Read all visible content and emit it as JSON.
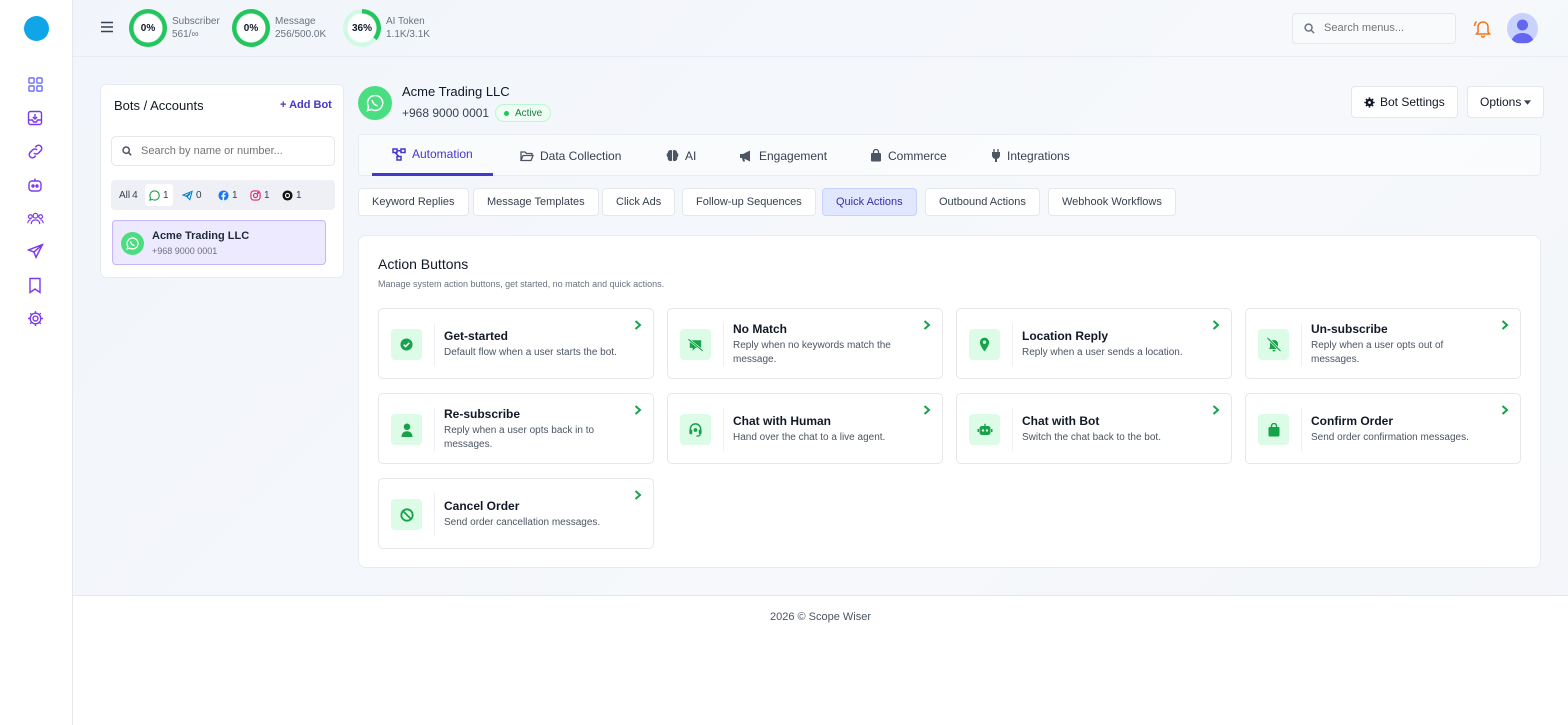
{
  "sidebar": {
    "icons": [
      "grid-icon",
      "inbox-icon",
      "link-icon",
      "robot-icon",
      "users-icon",
      "send-icon",
      "bookmark-icon",
      "gear-icon"
    ]
  },
  "topbar": {
    "stats": [
      {
        "pct": "0%",
        "label": "Subscriber",
        "value": "561/∞",
        "fill": 0
      },
      {
        "pct": "0%",
        "label": "Message",
        "value": "256/500.0K",
        "fill": 0
      },
      {
        "pct": "36%",
        "label": "AI Token",
        "value": "1.1K/3.1K",
        "fill": 36
      }
    ],
    "search_placeholder": "Search menus..."
  },
  "bots_panel": {
    "title": "Bots / Accounts",
    "add_label": "Add Bot",
    "search_placeholder": "Search by name or number...",
    "filters": [
      {
        "label": "All",
        "count": "4"
      },
      {
        "icon": "whatsapp-icon",
        "count": "1"
      },
      {
        "icon": "telegram-icon",
        "count": "0"
      },
      {
        "icon": "facebook-icon",
        "count": "1"
      },
      {
        "icon": "instagram-icon",
        "count": "1"
      },
      {
        "icon": "threads-icon",
        "count": "1"
      }
    ],
    "bots": [
      {
        "name": "Acme Trading LLC",
        "phone": "+968 9000 0001"
      }
    ]
  },
  "header": {
    "name": "Acme Trading LLC",
    "phone": "+968 9000 0001",
    "status": "Active",
    "settings_label": "Bot Settings",
    "options_label": "Options"
  },
  "tabs": [
    {
      "label": "Automation",
      "active": true
    },
    {
      "label": "Data Collection"
    },
    {
      "label": "AI"
    },
    {
      "label": "Engagement"
    },
    {
      "label": "Commerce"
    },
    {
      "label": "Integrations"
    }
  ],
  "subtabs": [
    {
      "label": "Keyword Replies"
    },
    {
      "label": "Message Templates"
    },
    {
      "label": "Click Ads"
    },
    {
      "label": "Follow-up Sequences"
    },
    {
      "label": "Quick Actions",
      "active": true
    },
    {
      "label": "Outbound Actions"
    },
    {
      "label": "Webhook Workflows"
    }
  ],
  "action_section": {
    "title": "Action Buttons",
    "subtitle": "Manage system action buttons, get started, no match and quick actions.",
    "items": [
      {
        "title": "Get-started",
        "desc": "Default flow when a user starts the bot.",
        "icon": "check-circle-icon"
      },
      {
        "title": "No Match",
        "desc": "Reply when no keywords match the message.",
        "icon": "no-comment-icon"
      },
      {
        "title": "Location Reply",
        "desc": "Reply when a user sends a location.",
        "icon": "map-pin-icon"
      },
      {
        "title": "Un-subscribe",
        "desc": "Reply when a user opts out of messages.",
        "icon": "bell-slash-icon"
      },
      {
        "title": "Re-subscribe",
        "desc": "Reply when a user opts back in to messages.",
        "icon": "user-icon"
      },
      {
        "title": "Chat with Human",
        "desc": "Hand over the chat to a live agent.",
        "icon": "headset-icon"
      },
      {
        "title": "Chat with Bot",
        "desc": "Switch the chat back to the bot.",
        "icon": "robot-icon"
      },
      {
        "title": "Confirm Order",
        "desc": "Send order confirmation messages.",
        "icon": "bag-icon"
      },
      {
        "title": "Cancel Order",
        "desc": "Send order cancellation messages.",
        "icon": "ban-icon"
      }
    ]
  },
  "footer": {
    "text": "2026 © Scope Wiser"
  }
}
